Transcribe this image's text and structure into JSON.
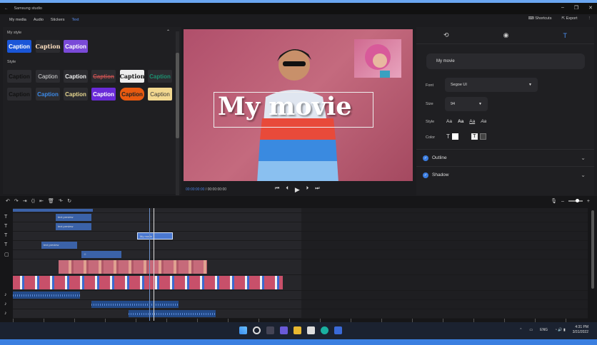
{
  "app": {
    "title": "Samsung studio",
    "shortcuts_label": "Shortcuts",
    "export_label": "Export"
  },
  "tabs": [
    "My media",
    "Audio",
    "Stickers",
    "Text"
  ],
  "left_panel": {
    "my_style_label": "My style",
    "style_label": "Style",
    "caption": "Caption"
  },
  "preview": {
    "title_text": "My movie",
    "current_time": "00:00:00:00",
    "total_time": "00:00:00:00"
  },
  "properties": {
    "text_value": "My movie",
    "font_label": "Font",
    "font_value": "Segoe UI",
    "size_label": "Size",
    "size_value": "94",
    "style_label": "Style",
    "style_options": [
      "Aa",
      "Aa",
      "Aa",
      "Aa"
    ],
    "color_label": "Color",
    "outline_label": "Outline",
    "shadow_label": "Shadow"
  },
  "timeline": {
    "clips": {
      "text1": "text preview",
      "text2": "text preview",
      "text3": "My movie",
      "text4": "text preview"
    }
  },
  "taskbar": {
    "language": "ENG",
    "time": "4:31 PM",
    "date": "3/31/2022"
  }
}
